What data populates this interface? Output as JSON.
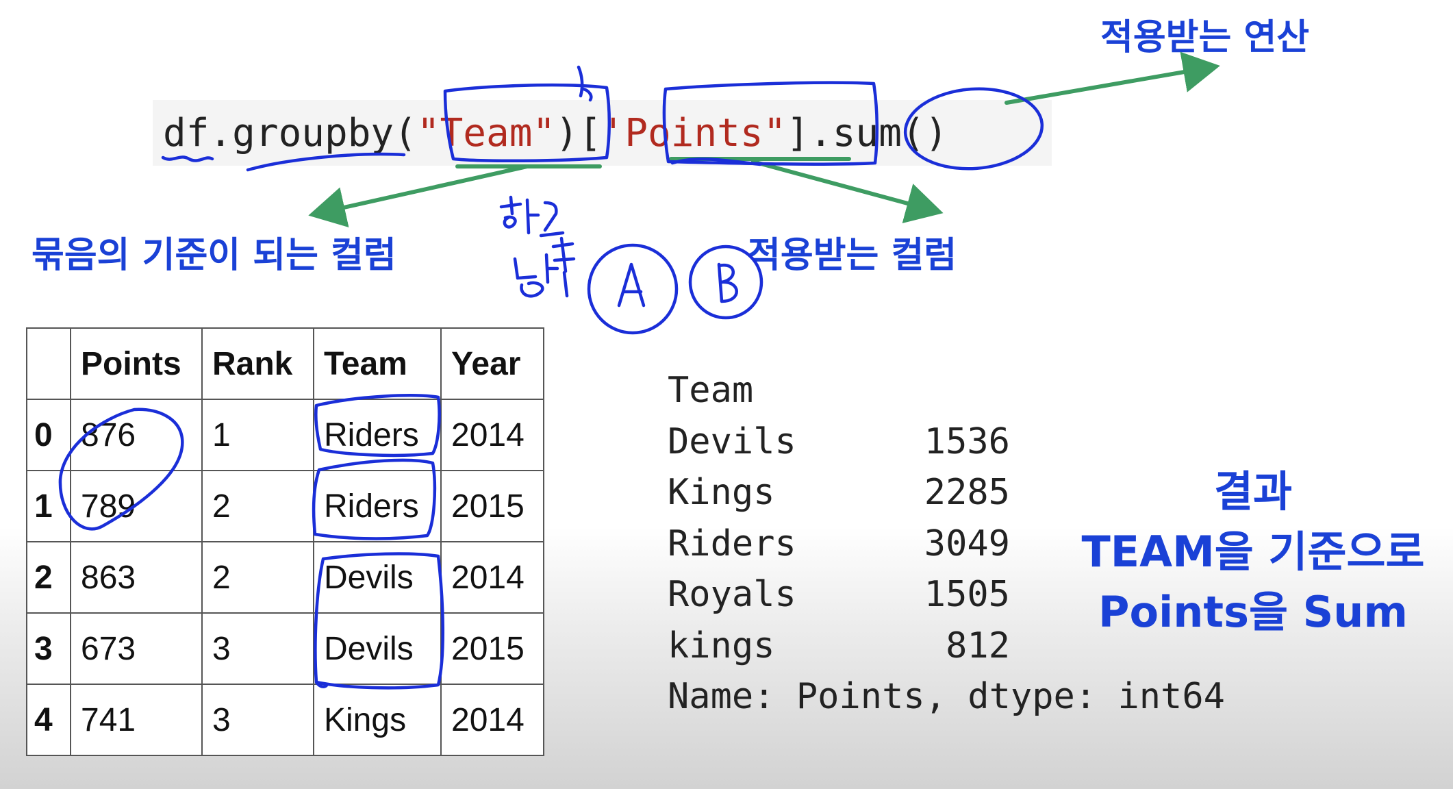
{
  "code": {
    "prefix": "df.groupby(",
    "group_key": "\"Team\"",
    "mid": ")[",
    "column": "'Points\"",
    "suffix": "].sum()"
  },
  "annotations": {
    "applied_operation": "적용받는 연산",
    "group_column": "묶음의 기준이 되는 컬럼",
    "applied_column": "적용받는 컬럼",
    "handwriting_school": "학교",
    "handwriting_gender": "남별",
    "circle_a": "A",
    "circle_b": "B",
    "result": [
      "결과",
      "TEAM을 기준으로",
      "Points을 Sum"
    ]
  },
  "table": {
    "headers": [
      "",
      "Points",
      "Rank",
      "Team",
      "Year"
    ],
    "rows": [
      [
        "0",
        "876",
        "1",
        "Riders",
        "2014"
      ],
      [
        "1",
        "789",
        "2",
        "Riders",
        "2015"
      ],
      [
        "2",
        "863",
        "2",
        "Devils",
        "2014"
      ],
      [
        "3",
        "673",
        "3",
        "Devils",
        "2015"
      ],
      [
        "4",
        "741",
        "3",
        "Kings",
        "2014"
      ]
    ]
  },
  "series": {
    "index_name": "Team",
    "rows": [
      {
        "key": "Devils",
        "value": "1536"
      },
      {
        "key": "Kings",
        "value": "2285"
      },
      {
        "key": "Riders",
        "value": "3049"
      },
      {
        "key": "Royals",
        "value": "1505"
      },
      {
        "key": "kings",
        "value": "812"
      }
    ],
    "footer": "Name: Points, dtype: int64"
  },
  "colors": {
    "ink_blue": "#1a2ed8",
    "arrow_green": "#3e9c62",
    "label_blue": "#1a41d6",
    "string_red": "#b12a1f"
  }
}
